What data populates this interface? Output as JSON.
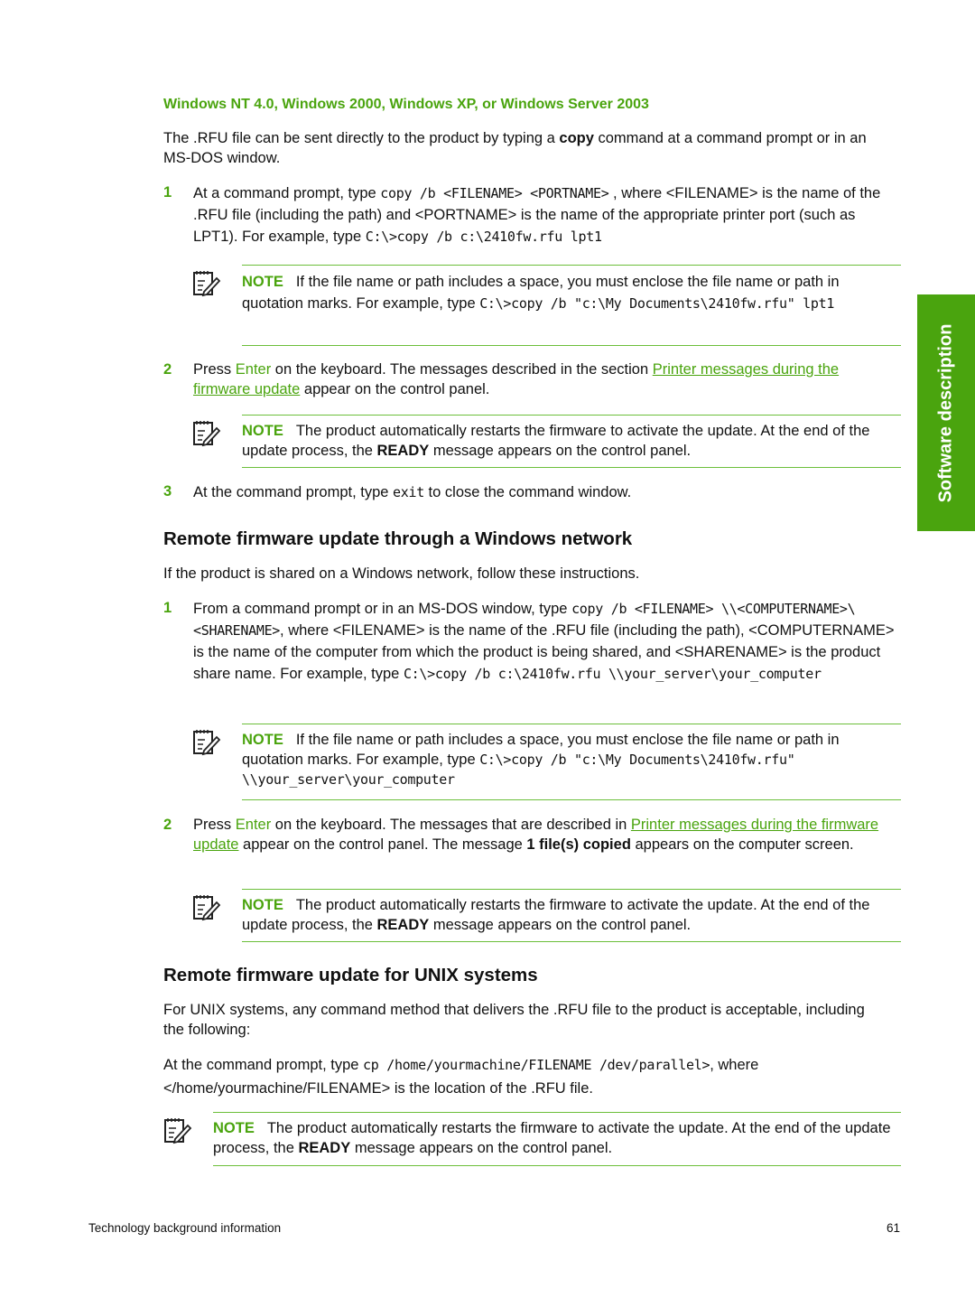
{
  "side_tab": {
    "label": "Software description"
  },
  "section_nt": {
    "heading": "Windows NT 4.0, Windows 2000, Windows XP, or Windows Server 2003",
    "intro": {
      "before": "The .RFU file can be sent directly to the product by typing a ",
      "bold": "copy",
      "after": " command at a command prompt or in an MS-DOS window."
    },
    "steps": [
      {
        "num": "1",
        "t1": "At a command prompt, type ",
        "c1": "copy /b <FILENAME> <PORTNAME>",
        "t2": " , where <FILENAME> is the name of the .RFU file (including the path) and <PORTNAME> is the name of the appropriate printer port (such as LPT1). For example, type ",
        "c2": "C:\\>copy /b c:\\2410fw.rfu lpt1",
        "note": {
          "label": "NOTE",
          "text": "If the file name or path includes a space, you must enclose the file name or path in quotation marks. For example, type ",
          "code": "C:\\>copy /b \"c:\\My Documents\\2410fw.rfu\" lpt1"
        }
      },
      {
        "num": "2",
        "t1": "Press ",
        "key": "Enter",
        "t2": " on the keyboard. The messages described in the section ",
        "link": "Printer messages during the firmware update",
        "t3": " appear on the control panel.",
        "note": {
          "label": "NOTE",
          "before": "The product automatically restarts the firmware to activate the update. At the end of the update process, the ",
          "bold": "READY",
          "after": " message appears on the control panel."
        }
      },
      {
        "num": "3",
        "t1": "At the command prompt, type ",
        "c1": "exit",
        "t2": " to close the command window."
      }
    ]
  },
  "section_network": {
    "heading": "Remote firmware update through a Windows network",
    "intro": "If the product is shared on a Windows network, follow these instructions.",
    "steps": [
      {
        "num": "1",
        "t1": "From a command prompt or in an MS-DOS window, type ",
        "c1": "copy /b <FILENAME> \\\\<COMPUTERNAME>\\<SHARENAME>",
        "t2": ", where <FILENAME> is the name of the .RFU file (including the path), <COMPUTERNAME> is the name of the computer from which the product is being shared, and <SHARENAME> is the product share name. For example, type ",
        "c2": "C:\\>copy /b c:\\2410fw.rfu \\\\your_server\\your_computer",
        "note": {
          "label": "NOTE",
          "text": "If the file name or path includes a space, you must enclose the file name or path in quotation marks. For example, type ",
          "code": "C:\\>copy /b \"c:\\My Documents\\2410fw.rfu\" \\\\your_server\\your_computer"
        }
      },
      {
        "num": "2",
        "t1": "Press ",
        "key": "Enter",
        "t2": " on the keyboard. The messages that are described in ",
        "link": "Printer messages during the firmware update",
        "t3": " appear on the control panel. The message ",
        "bold": "1 file(s) copied",
        "t4": " appears on the computer screen.",
        "note": {
          "label": "NOTE",
          "before": "The product automatically restarts the firmware to activate the update. At the end of the update process, the ",
          "bold": "READY",
          "after": " message appears on the control panel."
        }
      }
    ]
  },
  "section_unix": {
    "heading": "Remote firmware update for UNIX systems",
    "intro": "For UNIX systems, any command method that delivers the .RFU file to the product is acceptable, including the following:",
    "cmd": {
      "t1": "At the command prompt, type ",
      "c1": "cp /home/yourmachine/FILENAME /dev/parallel>",
      "t2": ", where </home/yourmachine/FILENAME> is the location of the .RFU file."
    },
    "note": {
      "label": "NOTE",
      "before": "The product automatically restarts the firmware to activate the update. At the end of the update process, the ",
      "bold": "READY",
      "after": " message appears on the control panel."
    }
  },
  "footer": {
    "left": "Technology background information",
    "page": "61"
  }
}
